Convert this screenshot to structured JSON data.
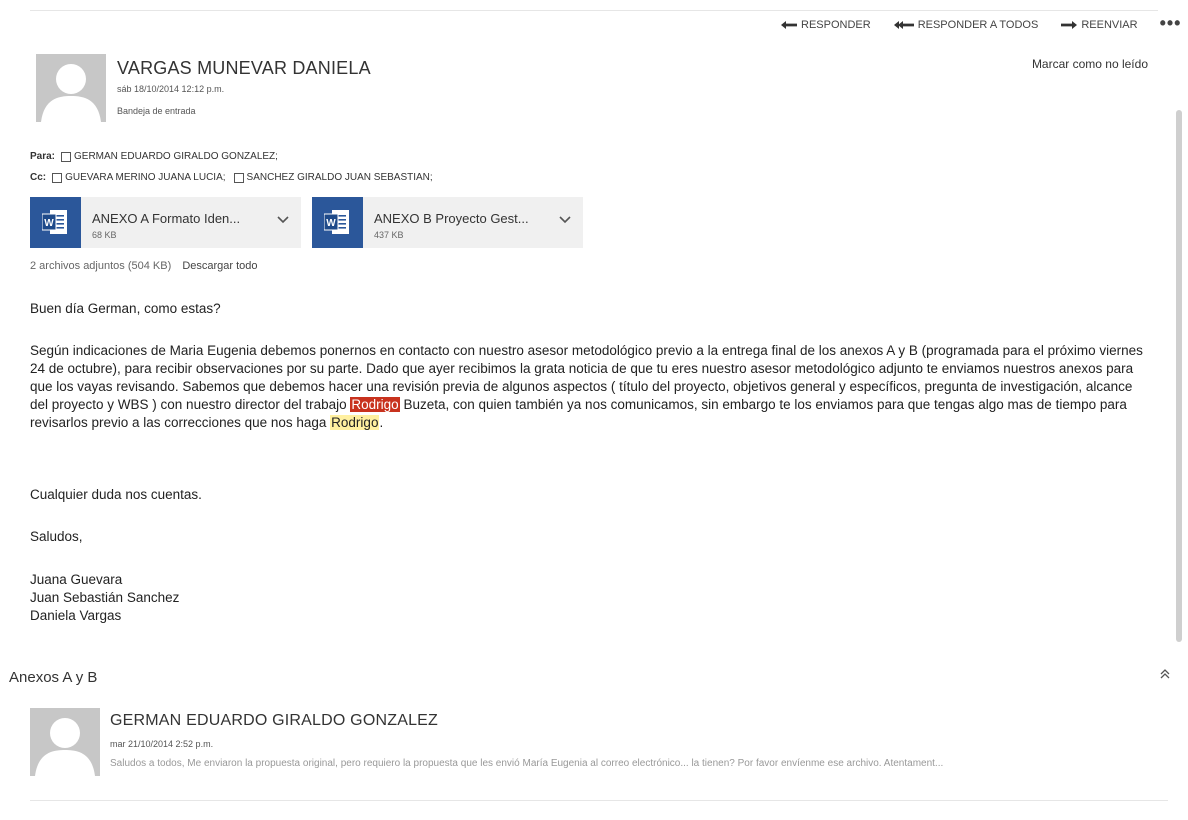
{
  "toolbar": {
    "reply": "RESPONDER",
    "reply_all": "RESPONDER A TODOS",
    "forward": "REENVIAR",
    "more": "•••",
    "mark_unread": "Marcar como no leído"
  },
  "message": {
    "sender": "VARGAS MUNEVAR DANIELA",
    "date": "sáb 18/10/2014 12:12 p.m.",
    "folder": "Bandeja de entrada",
    "to_label": "Para:",
    "to": [
      "GERMAN EDUARDO GIRALDO GONZALEZ;"
    ],
    "cc_label": "Cc:",
    "cc": [
      "GUEVARA MERINO JUANA LUCIA;",
      "SANCHEZ GIRALDO JUAN SEBASTIAN;"
    ],
    "attachments": [
      {
        "name": "ANEXO A Formato Iden...",
        "size": "68 KB",
        "icon": "word-doc-icon"
      },
      {
        "name": "ANEXO B Proyecto Gest...",
        "size": "437 KB",
        "icon": "word-doc-icon"
      }
    ],
    "attachments_summary": "2 archivos adjuntos (504 KB)",
    "download_all": "Descargar todo",
    "body": {
      "greeting": "Buen día German, como estas?",
      "p1_a": "Según indicaciones de Maria Eugenia debemos ponernos en contacto con nuestro asesor metodológico previo a la entrega final de los anexos A y B (programada para el próximo viernes 24 de octubre), para recibir observaciones por su parte. Dado que ayer recibimos la grata noticia de que tu eres nuestro asesor metodológico adjunto te enviamos nuestros anexos para que los vayas revisando. Sabemos que debemos hacer una revisión previa de algunos aspectos ( título del proyecto, objetivos general y específicos, pregunta de investigación, alcance del proyecto y WBS ) con nuestro director del trabajo ",
      "p1_highlight1": "Rodrigo",
      "p1_b": " Buzeta, con quien también ya nos comunicamos, sin embargo te los enviamos para que tengas algo mas de tiempo para revisarlos previo a las correcciones que nos haga ",
      "p1_highlight2": "Rodrigo",
      "p1_c": ".",
      "p2": "Cualquier duda nos cuentas.",
      "p3": "Saludos,",
      "sig1": "Juana Guevara",
      "sig2": "Juan Sebastián Sanchez",
      "sig3": "Daniela Vargas"
    }
  },
  "thread": {
    "subject": "Anexos A y B",
    "reply": {
      "sender": "GERMAN EDUARDO GIRALDO GONZALEZ",
      "date": "mar 21/10/2014 2:52 p.m.",
      "preview": "Saludos a todos, Me enviaron la propuesta original, pero requiero la propuesta que les envió María Eugenia al correo electrónico... la tienen? Por favor envíenme ese archivo. Atentament..."
    }
  },
  "colors": {
    "highlight_red": "#c8321e",
    "highlight_yellow": "#fff0a0",
    "word_blue": "#2b579a",
    "avatar_gray": "#c7c7c7"
  }
}
